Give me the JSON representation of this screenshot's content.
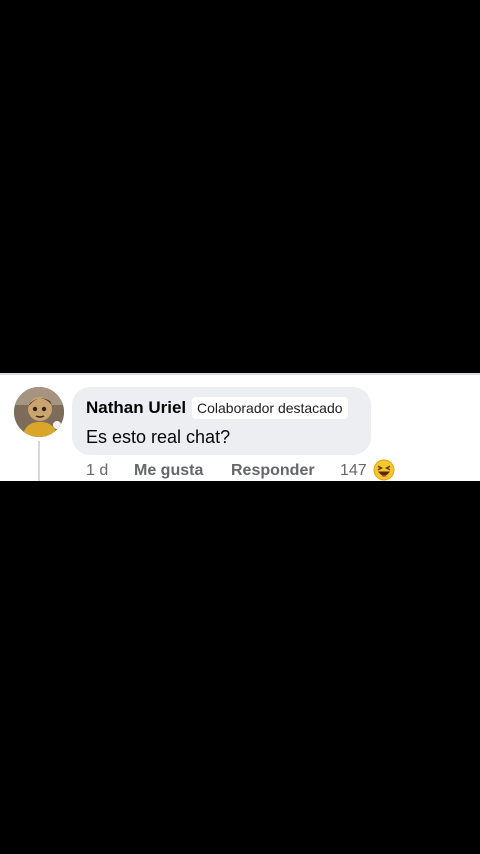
{
  "comment": {
    "author": "Nathan Uriel",
    "badge": "Colaborador destacado",
    "text": "Es esto real chat?",
    "time": "1 d",
    "like_label": "Me gusta",
    "reply_label": "Responder",
    "reaction_count": "147",
    "reaction_icon": "haha-reaction-icon"
  },
  "colors": {
    "background": "#000000",
    "comment_bg": "#ffffff",
    "bubble_bg": "#eceef1",
    "meta_text": "#65676b"
  }
}
